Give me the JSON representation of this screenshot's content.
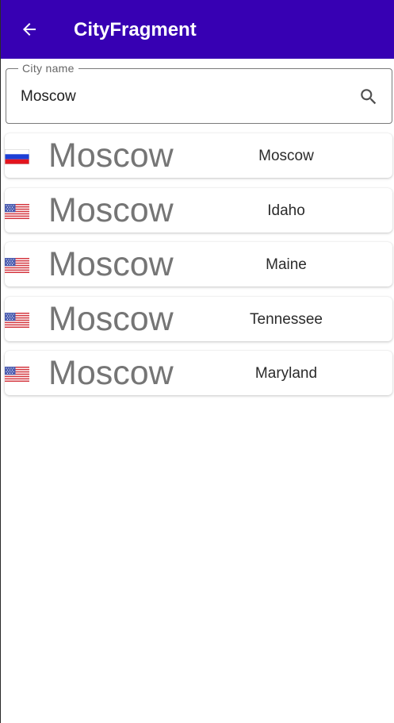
{
  "app_bar": {
    "title": "CityFragment",
    "back_icon": "arrow-back-icon",
    "background_color": "#3700b3"
  },
  "search": {
    "label": "City name",
    "value": "Moscow",
    "icon": "search-icon"
  },
  "results": [
    {
      "city": "Moscow",
      "region": "Moscow",
      "flag": "russia-flag-icon"
    },
    {
      "city": "Moscow",
      "region": "Idaho",
      "flag": "usa-flag-icon"
    },
    {
      "city": "Moscow",
      "region": "Maine",
      "flag": "usa-flag-icon"
    },
    {
      "city": "Moscow",
      "region": "Tennessee",
      "flag": "usa-flag-icon"
    },
    {
      "city": "Moscow",
      "region": "Maryland",
      "flag": "usa-flag-icon"
    }
  ]
}
